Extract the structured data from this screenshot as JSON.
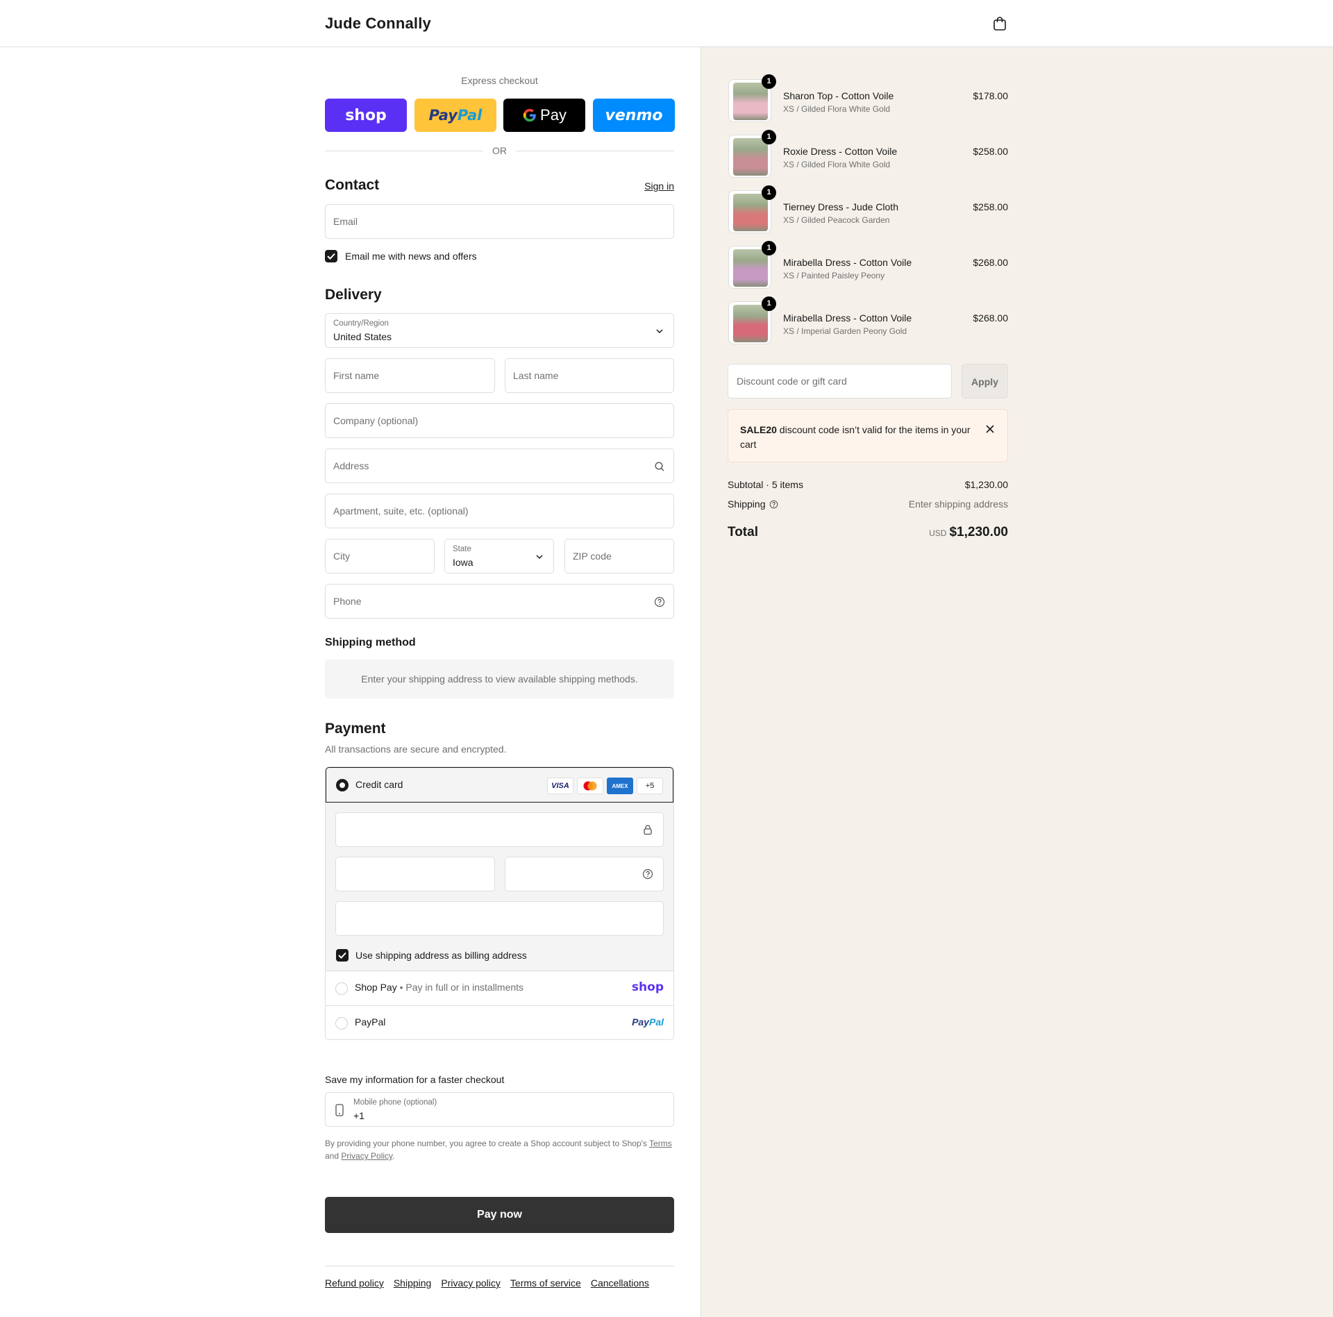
{
  "header": {
    "brand": "Jude Connally",
    "bag_icon": "shopping-bag-icon"
  },
  "express": {
    "title": "Express checkout",
    "shop": "shop",
    "paypal_a": "Pay",
    "paypal_b": "Pal",
    "gpay": "Pay",
    "venmo": "venmo",
    "or": "OR"
  },
  "contact": {
    "title": "Contact",
    "sign_in": "Sign in",
    "email_placeholder": "Email",
    "newsletter": "Email me with news and offers"
  },
  "delivery": {
    "title": "Delivery",
    "country_label": "Country/Region",
    "country_value": "United States",
    "first_name": "First name",
    "last_name": "Last name",
    "company": "Company (optional)",
    "address": "Address",
    "apartment": "Apartment, suite, etc. (optional)",
    "city": "City",
    "state_label": "State",
    "state_value": "Iowa",
    "zip": "ZIP code",
    "phone": "Phone"
  },
  "shipping": {
    "title": "Shipping method",
    "notice": "Enter your shipping address to view available shipping methods."
  },
  "payment": {
    "title": "Payment",
    "subtitle": "All transactions are secure and encrypted.",
    "credit_card": "Credit card",
    "cards": [
      "VISA",
      "AMEX",
      "+5"
    ],
    "billing_same": "Use shipping address as billing address",
    "shop_pay": "Shop Pay",
    "shop_pay_desc": "Pay in full or in installments",
    "shop_pay_logo": "shop",
    "paypal": "PayPal",
    "paypal_logo_a": "Pay",
    "paypal_logo_b": "Pal"
  },
  "save_info": {
    "title": "Save my information for a faster checkout",
    "mobile_label": "Mobile phone (optional)",
    "mobile_value": "+1",
    "legal_a": "By providing your phone number, you agree to create a Shop account subject to Shop's",
    "terms": "Terms",
    "and": "and",
    "privacy": "Privacy Policy",
    "period": "."
  },
  "pay_now": "Pay now",
  "footer": [
    "Refund policy",
    "Shipping",
    "Privacy policy",
    "Terms of service",
    "Cancellations"
  ],
  "cart": {
    "items": [
      {
        "qty": "1",
        "name": "Sharon Top - Cotton Voile",
        "variant": "XS / Gilded Flora White Gold",
        "price": "$178.00",
        "color": "#e9b9c6"
      },
      {
        "qty": "1",
        "name": "Roxie Dress - Cotton Voile",
        "variant": "XS / Gilded Flora White Gold",
        "price": "$258.00",
        "color": "#c98f96"
      },
      {
        "qty": "1",
        "name": "Tierney Dress - Jude Cloth",
        "variant": "XS / Gilded Peacock Garden",
        "price": "$258.00",
        "color": "#d97878"
      },
      {
        "qty": "1",
        "name": "Mirabella Dress - Cotton Voile",
        "variant": "XS / Painted Paisley Peony",
        "price": "$268.00",
        "color": "#c79ac4"
      },
      {
        "qty": "1",
        "name": "Mirabella Dress - Cotton Voile",
        "variant": "XS / Imperial Garden Peony Gold",
        "price": "$268.00",
        "color": "#d66a78"
      }
    ],
    "discount_placeholder": "Discount code or gift card",
    "apply": "Apply",
    "warning_code": "SALE20",
    "warning_text": " discount code isn’t valid for the items in your cart",
    "subtotal_label": "Subtotal · 5 items",
    "subtotal_value": "$1,230.00",
    "shipping_label": "Shipping",
    "shipping_value": "Enter shipping address",
    "total_label": "Total",
    "currency": "USD",
    "total_value": "$1,230.00"
  }
}
